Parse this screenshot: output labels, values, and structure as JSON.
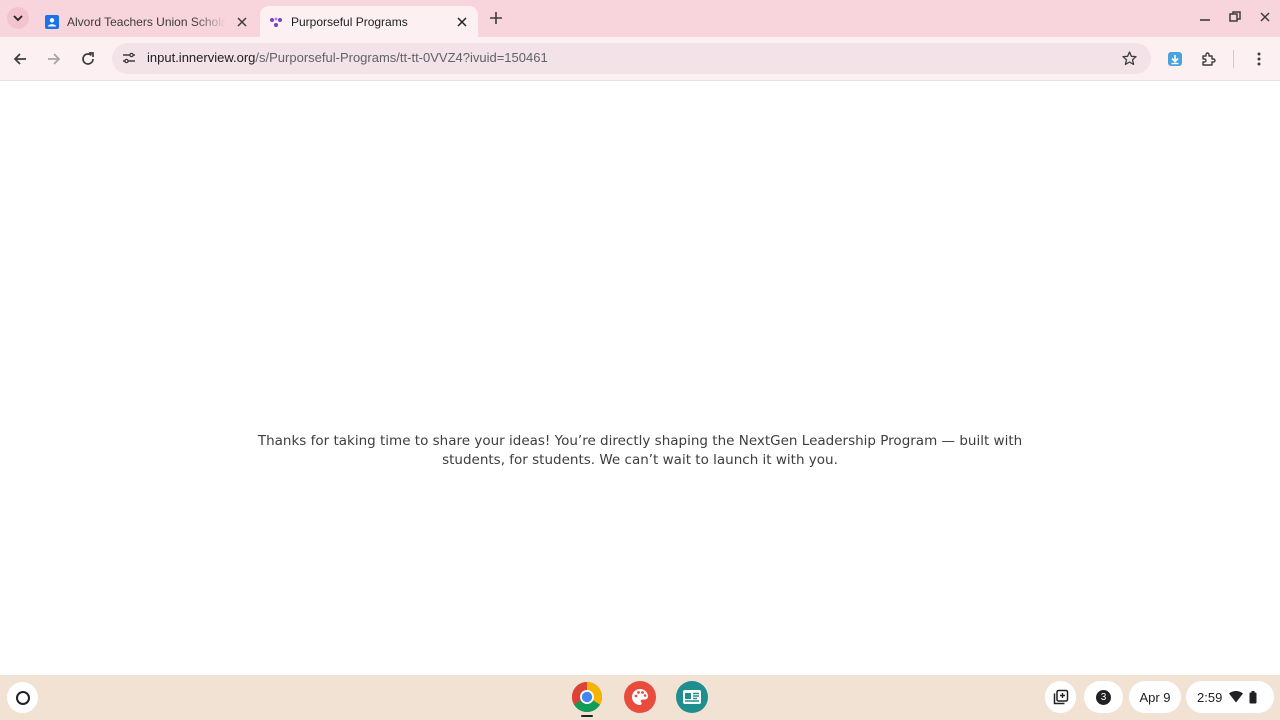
{
  "browser": {
    "tabs": [
      {
        "title": "Alvord Teachers Union Scholarship",
        "active": false
      },
      {
        "title": "Purporseful Programs",
        "active": true
      }
    ],
    "url": {
      "domain": "input.innerview.org",
      "path": "/s/Purporseful-Programs/tt-tt-0VVZ4?ivuid=150461"
    }
  },
  "page": {
    "message_line1": "Thanks for taking  time to share your ideas! You’re directly shaping the NextGen Leadership Program — built with",
    "message_line2": "students, for students. We can’t wait to launch it with you."
  },
  "shelf": {
    "apps": [
      "chrome",
      "canvas",
      "classroom"
    ],
    "notification_count": "3",
    "date": "Apr 9",
    "time": "2:59"
  },
  "colors": {
    "tabstrip": "#f8d4dc",
    "toolbar": "#fdf0f2",
    "omnibox": "#f3e2e7",
    "shelf": "#f2e2d4"
  }
}
